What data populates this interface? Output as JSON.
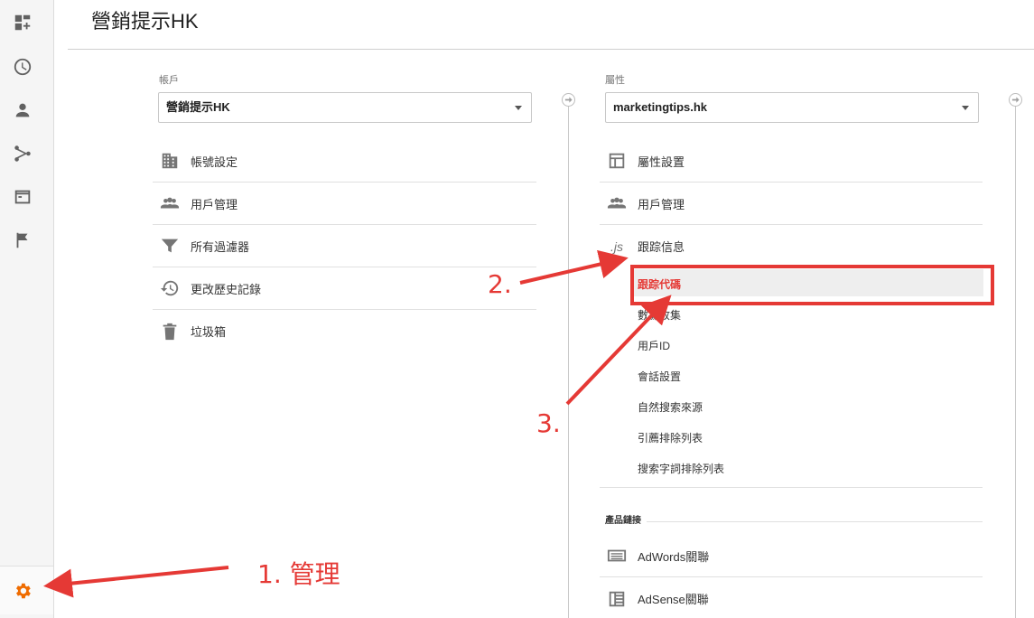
{
  "page_title": "營銷提示HK",
  "account": {
    "label": "帳戶",
    "selected": "營銷提示HK",
    "items": [
      {
        "icon": "building-icon",
        "label": "帳號設定"
      },
      {
        "icon": "people-icon",
        "label": "用戶管理"
      },
      {
        "icon": "filter-icon",
        "label": "所有過濾器"
      },
      {
        "icon": "history-icon",
        "label": "更改歷史記錄"
      },
      {
        "icon": "trash-icon",
        "label": "垃圾箱"
      }
    ]
  },
  "property": {
    "label": "屬性",
    "selected": "marketingtips.hk",
    "items": [
      {
        "icon": "layout-icon",
        "label": "屬性設置"
      },
      {
        "icon": "people-icon",
        "label": "用戶管理"
      },
      {
        "icon": "js-icon",
        "label": "跟踪信息",
        "icon_text": ".js"
      }
    ],
    "tracking_sub": [
      "跟踪代碼",
      "數據收集",
      "用戶ID",
      "會話設置",
      "自然搜索來源",
      "引薦排除列表",
      "搜索字詞排除列表"
    ],
    "product_links_heading": "產品鏈接",
    "product_links": [
      {
        "icon": "adwords-icon",
        "label": "AdWords關聯"
      },
      {
        "icon": "adsense-icon",
        "label": "AdSense關聯"
      }
    ]
  },
  "annotations": {
    "step1": "1. 管理",
    "step2": "2.",
    "step3": "3.",
    "color": "#e53935"
  },
  "colors": {
    "accent_orange": "#ef6c00",
    "highlight_red": "#e53935"
  }
}
